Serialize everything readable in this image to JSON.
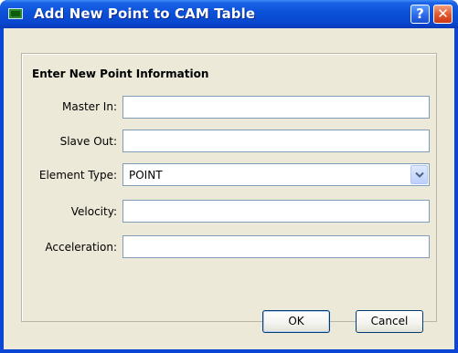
{
  "window": {
    "title": "Add New Point to CAM Table",
    "help_label": "?",
    "close_label": "✕"
  },
  "form": {
    "section_title": "Enter New Point Information",
    "fields": [
      {
        "label": "Master In:",
        "value": ""
      },
      {
        "label": "Slave Out:",
        "value": ""
      },
      {
        "label": "Element Type:",
        "value": "POINT"
      },
      {
        "label": "Velocity:",
        "value": ""
      },
      {
        "label": "Acceleration:",
        "value": ""
      }
    ]
  },
  "buttons": {
    "ok": "OK",
    "cancel": "Cancel"
  },
  "colors": {
    "titlebar": "#0a50d8",
    "client_bg": "#ece9d8",
    "field_border": "#7f9db9"
  },
  "icons": [
    "app-icon",
    "help-icon",
    "close-icon",
    "chevron-down-icon"
  ]
}
